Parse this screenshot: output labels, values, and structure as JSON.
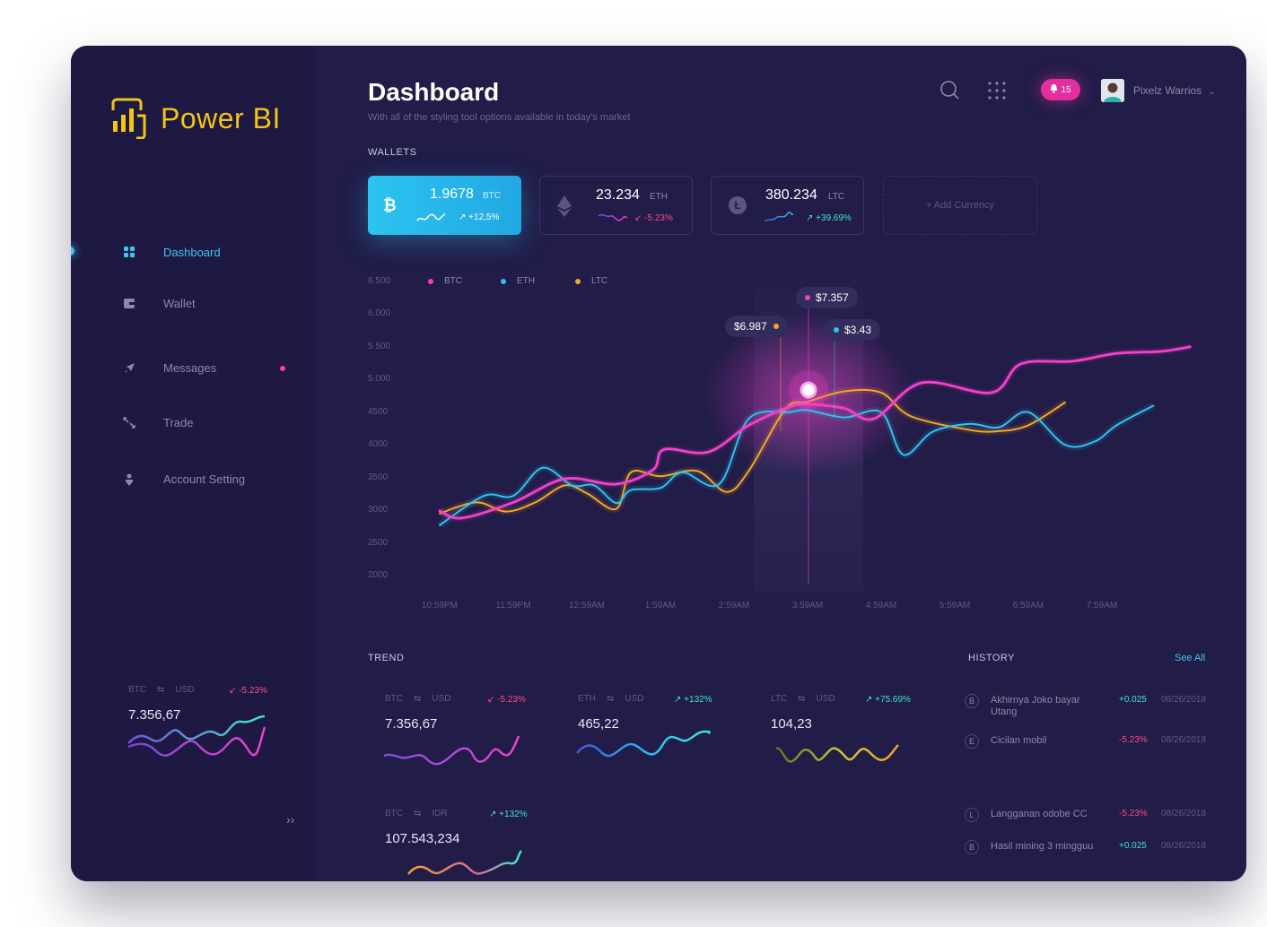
{
  "brand": {
    "name": "Power BI"
  },
  "sidebar": {
    "items": [
      {
        "label": "Dashboard",
        "icon": "dashboard-icon"
      },
      {
        "label": "Wallet",
        "icon": "wallet-icon"
      },
      {
        "label": "Messages",
        "icon": "rocket-icon"
      },
      {
        "label": "Trade",
        "icon": "arrows-icon"
      },
      {
        "label": "Account Setting",
        "icon": "user-icon"
      }
    ],
    "ticker": {
      "from": "BTC",
      "to": "USD",
      "change": "-5.23%",
      "value": "7.356,67"
    },
    "collapse": "››"
  },
  "header": {
    "title": "Dashboard",
    "subtitle": "With all of the styling tool options available in today's market",
    "notifications": "15",
    "user": "Pixelz Warrios"
  },
  "wallets": {
    "label": "WALLETS",
    "items": [
      {
        "amount": "1.9678",
        "symbol": "BTC",
        "change": "+12,5%"
      },
      {
        "amount": "23.234",
        "symbol": "ETH",
        "change": "-5.23%"
      },
      {
        "amount": "380.234",
        "symbol": "LTC",
        "change": "+39.69%"
      }
    ],
    "add": "+ Add Currency"
  },
  "chart_data": {
    "type": "line",
    "x": [
      "10:59PM",
      "11:59PM",
      "12:59AM",
      "1:59AM",
      "2:59AM",
      "3:59AM",
      "4:59AM",
      "5:59AM",
      "6:59AM",
      "7:59AM"
    ],
    "y_ticks": [
      "6.500",
      "6.000",
      "5.500",
      "5.000",
      "4500",
      "4000",
      "3500",
      "3000",
      "2500",
      "2000"
    ],
    "ylim": [
      2000,
      6500
    ],
    "legend_position": "top",
    "series": [
      {
        "name": "BTC",
        "color": "#f23fc9",
        "points": [
          [
            0,
            2990
          ],
          [
            0.3,
            2880
          ],
          [
            1.0,
            3120
          ],
          [
            1.7,
            3480
          ],
          [
            2.4,
            3400
          ],
          [
            2.9,
            3620
          ],
          [
            3.05,
            3930
          ],
          [
            3.65,
            3890
          ],
          [
            4.2,
            4300
          ],
          [
            4.75,
            4580
          ],
          [
            5.0,
            4620
          ],
          [
            5.5,
            4560
          ],
          [
            5.9,
            4400
          ],
          [
            6.55,
            4950
          ],
          [
            7.5,
            4800
          ],
          [
            7.9,
            5240
          ],
          [
            8.6,
            5280
          ],
          [
            9.2,
            5400
          ],
          [
            9.8,
            5430
          ],
          [
            10.2,
            5500
          ]
        ]
      },
      {
        "name": "ETH",
        "color": "#2cc4ef",
        "points": [
          [
            0,
            2770
          ],
          [
            0.6,
            3220
          ],
          [
            1.0,
            3220
          ],
          [
            1.4,
            3650
          ],
          [
            1.8,
            3380
          ],
          [
            2.1,
            3380
          ],
          [
            2.4,
            3110
          ],
          [
            2.6,
            3310
          ],
          [
            3.0,
            3340
          ],
          [
            3.3,
            3580
          ],
          [
            3.8,
            3400
          ],
          [
            4.2,
            4400
          ],
          [
            4.75,
            4500
          ],
          [
            5.0,
            4530
          ],
          [
            5.5,
            4420
          ],
          [
            6.0,
            4500
          ],
          [
            6.3,
            3850
          ],
          [
            6.7,
            4200
          ],
          [
            7.2,
            4320
          ],
          [
            7.6,
            4270
          ],
          [
            8.0,
            4500
          ],
          [
            8.5,
            4000
          ],
          [
            8.9,
            4050
          ],
          [
            9.2,
            4300
          ],
          [
            9.7,
            4600
          ]
        ]
      },
      {
        "name": "LTC",
        "color": "#f5a623",
        "points": [
          [
            0,
            2950
          ],
          [
            0.5,
            3120
          ],
          [
            0.9,
            2980
          ],
          [
            1.3,
            3120
          ],
          [
            1.7,
            3380
          ],
          [
            2.0,
            3260
          ],
          [
            2.4,
            3020
          ],
          [
            2.6,
            3580
          ],
          [
            3.0,
            3520
          ],
          [
            3.5,
            3600
          ],
          [
            3.9,
            3280
          ],
          [
            4.2,
            3600
          ],
          [
            4.7,
            4550
          ],
          [
            5.0,
            4660
          ],
          [
            5.5,
            4820
          ],
          [
            6.0,
            4800
          ],
          [
            6.4,
            4440
          ],
          [
            7.2,
            4230
          ],
          [
            7.6,
            4210
          ],
          [
            8.0,
            4300
          ],
          [
            8.5,
            4650
          ]
        ]
      }
    ],
    "tooltips": [
      {
        "series": "BTC",
        "value": "$7.357"
      },
      {
        "series": "LTC",
        "value": "$6.987"
      },
      {
        "series": "ETH",
        "value": "$3.43"
      }
    ]
  },
  "trend": {
    "label": "TREND",
    "cards": [
      {
        "from": "BTC",
        "to": "USD",
        "change": "-5.23%",
        "value": "7.356,67"
      },
      {
        "from": "ETH",
        "to": "USD",
        "change": "+132%",
        "value": "465,22"
      },
      {
        "from": "LTC",
        "to": "USD",
        "change": "+75.69%",
        "value": "104,23"
      },
      {
        "from": "BTC",
        "to": "IDR",
        "change": "+132%",
        "value": "107.543,234"
      }
    ]
  },
  "history": {
    "label": "HISTORY",
    "see_all": "See All",
    "items": [
      {
        "coin": "B",
        "title": "Akhirnya Joko bayar Utang",
        "amount": "+0.025",
        "date": "08/26/2018"
      },
      {
        "coin": "E",
        "title": "Cicilan mobil",
        "amount": "-5.23%",
        "date": "08/26/2018"
      },
      {
        "coin": "L",
        "title": "Langganan odobe CC",
        "amount": "-5.23%",
        "date": "08/26/2018"
      },
      {
        "coin": "B",
        "title": "Hasil mining 3 mingguu",
        "amount": "+0.025",
        "date": "08/26/2018"
      }
    ]
  }
}
